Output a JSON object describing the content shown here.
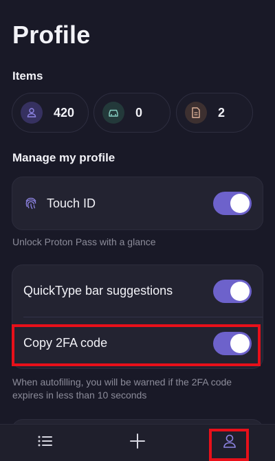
{
  "page": {
    "title": "Profile"
  },
  "items": {
    "title": "Items",
    "stats": [
      {
        "icon": "person-icon",
        "value": "420",
        "icon_bg": "#363160",
        "icon_color": "#8f85e6"
      },
      {
        "icon": "car-icon",
        "value": "0",
        "icon_bg": "#23393a",
        "icon_color": "#8ad3c6"
      },
      {
        "icon": "note-icon",
        "value": "2",
        "icon_bg": "#3d3030",
        "icon_color": "#e0b39a"
      }
    ]
  },
  "manage": {
    "title": "Manage my profile",
    "touch_id_label": "Touch ID",
    "touch_id_caption": "Unlock Proton Pass with a glance",
    "quicktype_label": "QuickType bar suggestions",
    "copy_2fa_label": "Copy 2FA code",
    "autofill_caption": "When autofilling, you will be warned if the 2FA code expires in less than 10 seconds"
  },
  "toggles": {
    "touch_id": true,
    "quicktype": true,
    "copy_2fa": true
  },
  "tabbar": {
    "tabs": [
      {
        "icon": "list-icon"
      },
      {
        "icon": "plus-icon"
      },
      {
        "icon": "profile-icon",
        "active": true
      }
    ]
  },
  "colors": {
    "accent": "#6d62cb",
    "highlight": "#e8101a",
    "background": "#191927"
  }
}
